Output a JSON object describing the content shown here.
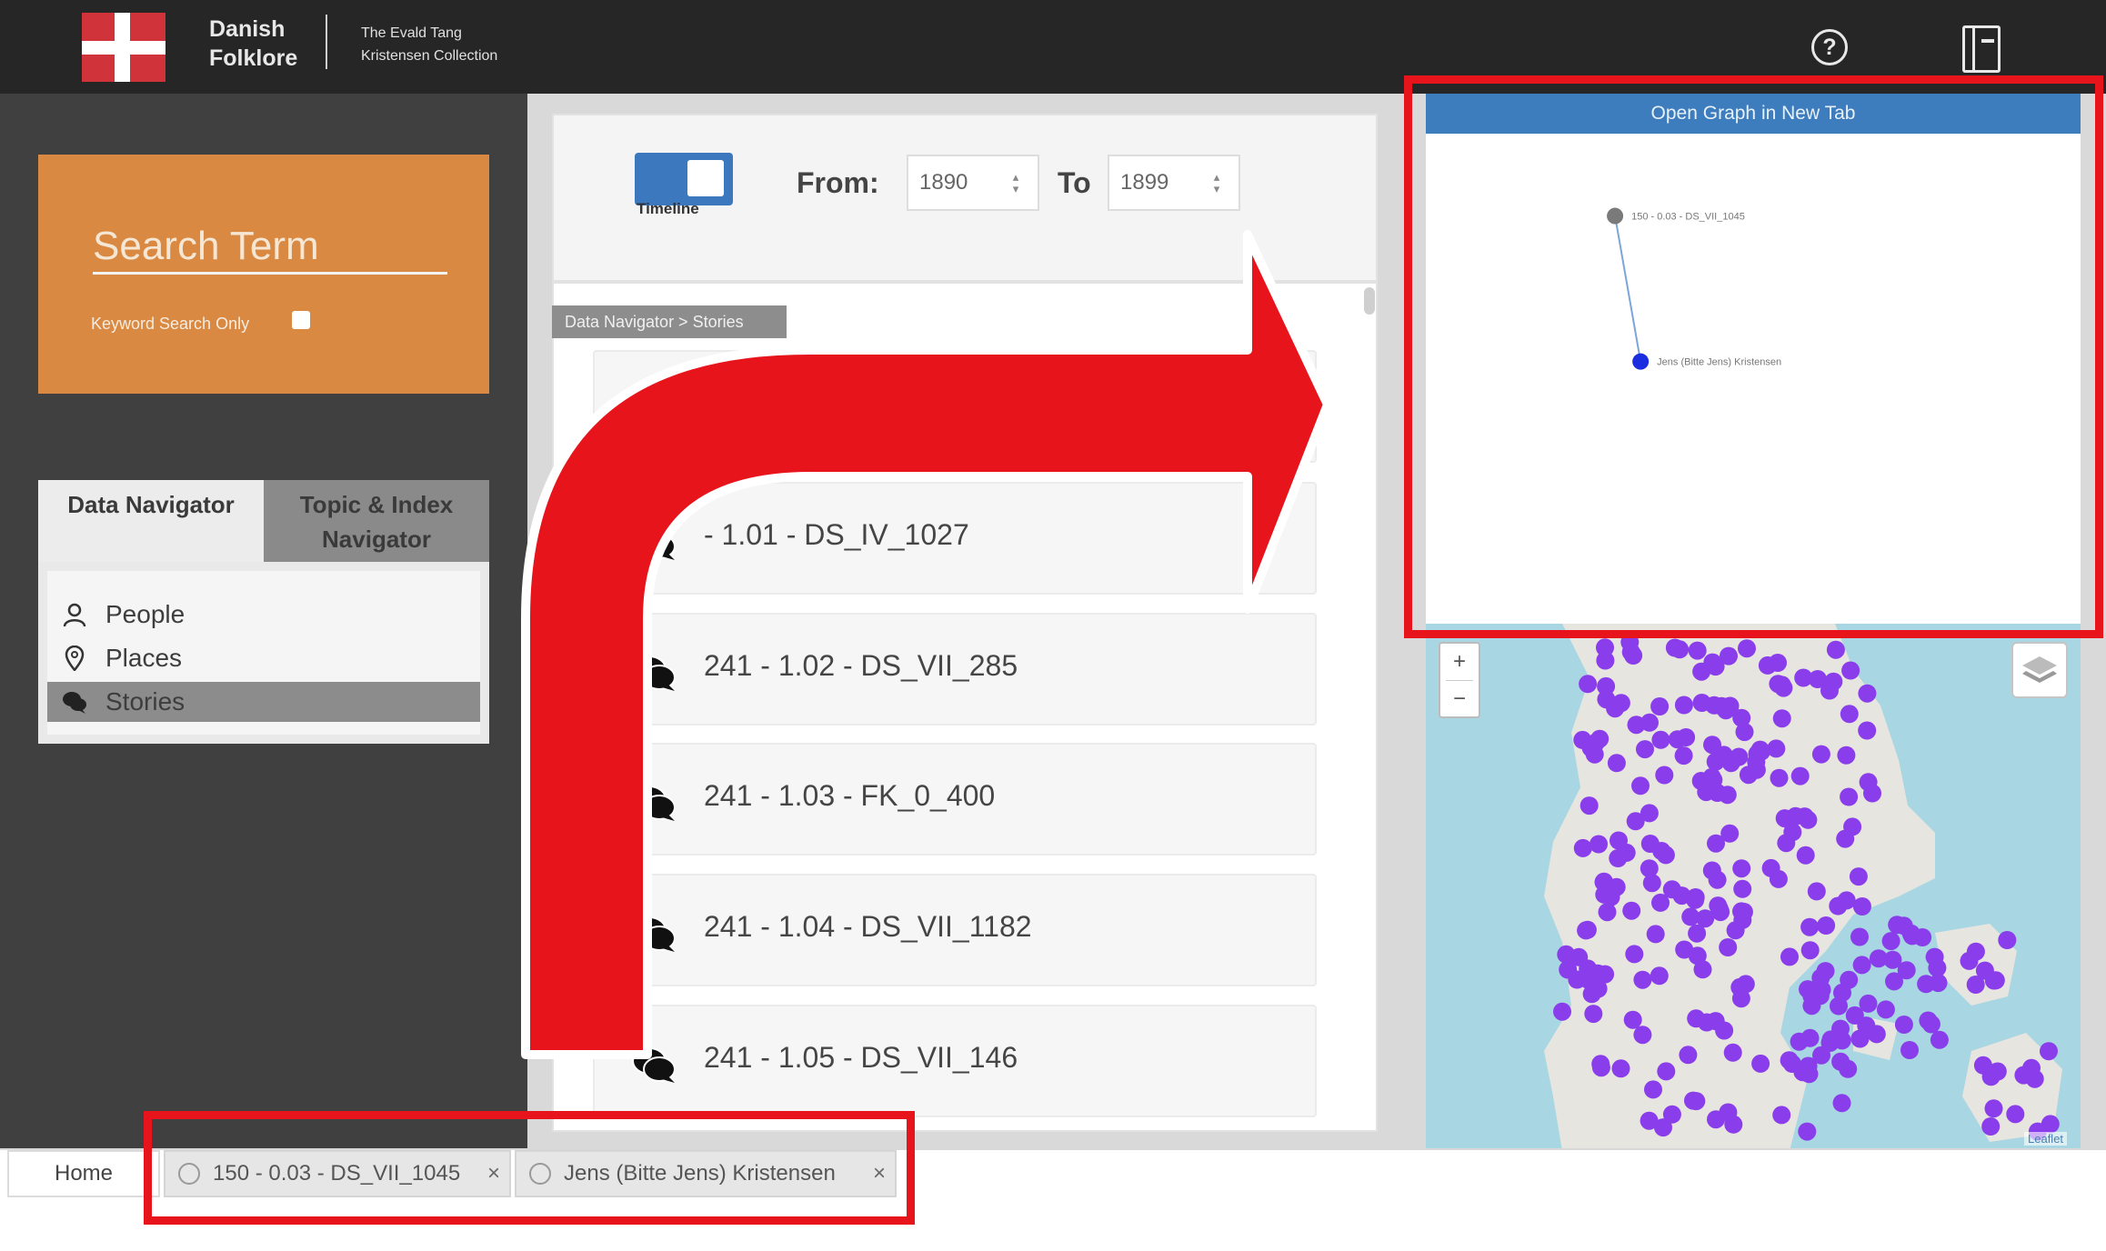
{
  "header": {
    "brand_line1": "Danish",
    "brand_line2": "Folklore",
    "collection_line1": "The Evald Tang",
    "collection_line2": "Kristensen Collection",
    "help_glyph": "?"
  },
  "search": {
    "placeholder": "Search Term",
    "keyword_only_label": "Keyword Search Only"
  },
  "navigator": {
    "tabs": [
      {
        "label": "Data Navigator"
      },
      {
        "label_line1": "Topic & Index",
        "label_line2": "Navigator"
      }
    ],
    "items": [
      {
        "label": "People",
        "icon": "person-icon"
      },
      {
        "label": "Places",
        "icon": "map-pin-icon"
      },
      {
        "label": "Stories",
        "icon": "speech-bubble-icon",
        "selected": true
      }
    ]
  },
  "timeline": {
    "toggle_label": "Timeline",
    "from_label": "From:",
    "from_value": "1890",
    "to_label": "To",
    "to_value": "1899"
  },
  "stories": {
    "breadcrumb": "Data Navigator > Stories",
    "items": [
      {
        "label": ""
      },
      {
        "label": "- 1.01 - DS_IV_1027"
      },
      {
        "label": "241 - 1.02 - DS_VII_285"
      },
      {
        "label": "241 - 1.03 - FK_0_400"
      },
      {
        "label": "241 - 1.04 - DS_VII_1182"
      },
      {
        "label": "241 - 1.05 - DS_VII_146"
      }
    ]
  },
  "graph": {
    "open_button": "Open Graph in New Tab",
    "nodes": [
      {
        "label": "150 - 0.03 - DS_VII_1045",
        "color": "#7a7a7a",
        "fx": 0.289,
        "fy": 0.168
      },
      {
        "label": "Jens (Bitte Jens) Kristensen",
        "color": "#1a2ee0",
        "fx": 0.328,
        "fy": 0.465
      }
    ]
  },
  "map": {
    "zoom_in": "+",
    "zoom_out": "−",
    "attribution": "Leaflet",
    "marker_color": "#8a3dea",
    "land_color": "#e7e5df",
    "water_color": "#a8d6e2"
  },
  "tabs_bar": {
    "home": "Home",
    "open_tabs": [
      {
        "label": "150 - 0.03 - DS_VII_1045"
      },
      {
        "label": "Jens (Bitte Jens) Kristensen"
      }
    ],
    "close_glyph": "×"
  },
  "annotation": {
    "highlight_color": "#e8141c"
  }
}
